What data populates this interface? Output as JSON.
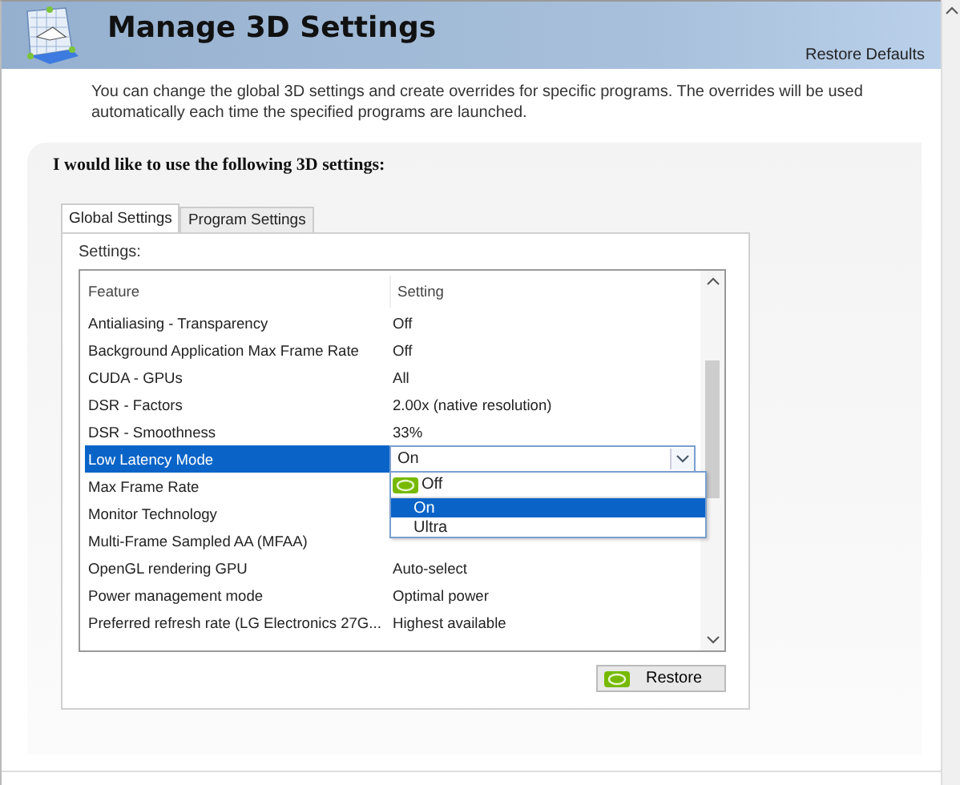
{
  "header": {
    "title": "Manage 3D Settings",
    "restore_defaults": "Restore Defaults"
  },
  "description": "You can change the global 3D settings and create overrides for specific programs. The overrides will be used automatically each time the specified programs are launched.",
  "panel": {
    "heading": "I would like to use the following 3D settings:"
  },
  "tabs": [
    {
      "label": "Global Settings",
      "selected": true
    },
    {
      "label": "Program Settings",
      "selected": false
    }
  ],
  "settings_label": "Settings:",
  "table": {
    "columns": [
      "Feature",
      "Setting"
    ],
    "rows": [
      {
        "feature": "Antialiasing - Transparency",
        "setting": "Off",
        "selected": false
      },
      {
        "feature": "Background Application Max Frame Rate",
        "setting": "Off",
        "selected": false
      },
      {
        "feature": "CUDA - GPUs",
        "setting": "All",
        "selected": false
      },
      {
        "feature": "DSR - Factors",
        "setting": "2.00x (native resolution)",
        "selected": false
      },
      {
        "feature": "DSR - Smoothness",
        "setting": "33%",
        "selected": false
      },
      {
        "feature": "Low Latency Mode",
        "setting": "On",
        "selected": true
      },
      {
        "feature": "Max Frame Rate",
        "selected": false
      },
      {
        "feature": "Monitor Technology",
        "selected": false
      },
      {
        "feature": "Multi-Frame Sampled AA (MFAA)",
        "selected": false
      },
      {
        "feature": "OpenGL rendering GPU",
        "setting": "Auto-select",
        "selected": false
      },
      {
        "feature": "Power management mode",
        "setting": "Optimal power",
        "selected": false
      },
      {
        "feature": "Preferred refresh rate (LG Electronics 27G...",
        "setting": "Highest available",
        "selected": false
      }
    ]
  },
  "dropdown": {
    "options": [
      {
        "label": "Off",
        "selected": false
      },
      {
        "label": "On",
        "selected": true
      },
      {
        "label": "Ultra",
        "selected": false
      }
    ]
  },
  "restore_button": "Restore"
}
